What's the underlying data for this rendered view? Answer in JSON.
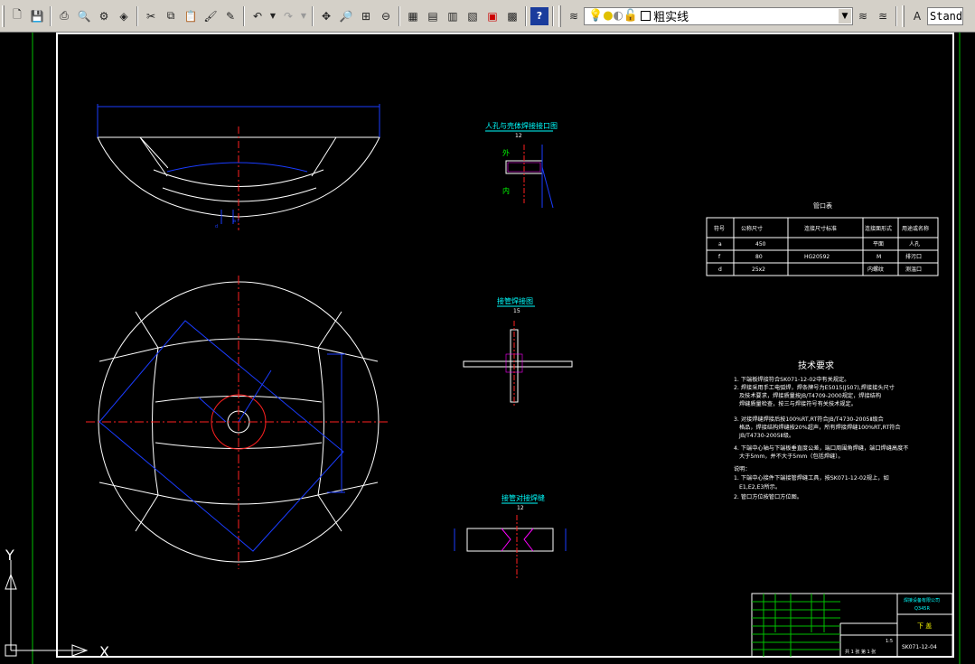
{
  "toolbar": {
    "layer_name": "粗实线",
    "text_style": "Standa",
    "buttons": [
      "new",
      "open",
      "save",
      "print",
      "plot-preview",
      "publish",
      "3d-dwf",
      "cut",
      "copy",
      "paste",
      "match-properties",
      "block-editor",
      "undo",
      "redo",
      "pan",
      "zoom-realtime",
      "zoom-window",
      "zoom-previous",
      "properties",
      "design-center",
      "tool-palettes",
      "sheet-set",
      "markup",
      "quickcalc",
      "help"
    ]
  },
  "drawing": {
    "detail_views": [
      {
        "title": "人孔与壳体焊接接口图",
        "scale": "12"
      },
      {
        "title": "接管焊接图",
        "scale": "15"
      },
      {
        "title": "接管对接焊缝",
        "scale": "12"
      }
    ],
    "detail1_labels": {
      "outer": "外",
      "inner": "内"
    },
    "nozzle_table": {
      "title": "管口表",
      "headers": [
        "符号",
        "公称尺寸",
        "连接尺寸标准",
        "连接面形式",
        "用途或名称"
      ],
      "rows": [
        [
          "a",
          "450",
          "",
          "平面",
          "人孔"
        ],
        [
          "f",
          "80",
          "HG20592",
          "M",
          "排污口"
        ],
        [
          "d",
          "25x2",
          "",
          "内螺纹",
          "测温口"
        ]
      ]
    },
    "tech_requirements": {
      "title": "技术要求",
      "lines": [
        "1. 下端板焊接符合SK071-12-02中有关规定。",
        "2. 焊接采用手工电弧焊，焊条牌号为E5015(J507),焊接接头尺寸",
        "及技术要求，焊接质量按JB/T4709-2000规定，焊接结构",
        "焊缝质量检查，按三与焊接符号有关技术规定。",
        "3. 对接焊缝焊接后按100%RT,RT符合JB/T4730-2005Ⅱ级合",
        "格品，焊接结构焊缝按20%超声，所有焊接焊缝100%RT,RT符合",
        "JB/T4730-2005Ⅱ级。",
        "4. 下端中心轴与下端板垂直度公差，端口周围角焊缝，端口焊缝高度不",
        "大于5mm，并不大于5mm（包括焊缝）。",
        "说明：",
        "1. 下端中心接件下端接管焊缝工具，按SK071-12-02规上，如",
        "E1,E2,E3所示。",
        "2. 管口方位按管口方位图。"
      ]
    },
    "title_block": {
      "company": "焊接设备有限公司",
      "part_name": "下 盖",
      "drawing_no": "SK071-12-04",
      "scale": "1:5",
      "sheet": "共 1 张  第 1 张",
      "material": "Q345R"
    },
    "ucs": {
      "y": "Y",
      "x": "X"
    }
  },
  "colors": {
    "background": "#000000",
    "white": "#ffffff",
    "red_centerline": "#ff2020",
    "blue_dim": "#1a3cff",
    "cyan": "#00ffff",
    "green_frame": "#00c000",
    "magenta_hatch": "#ff00ff",
    "toolbar": "#d4d0c8"
  }
}
